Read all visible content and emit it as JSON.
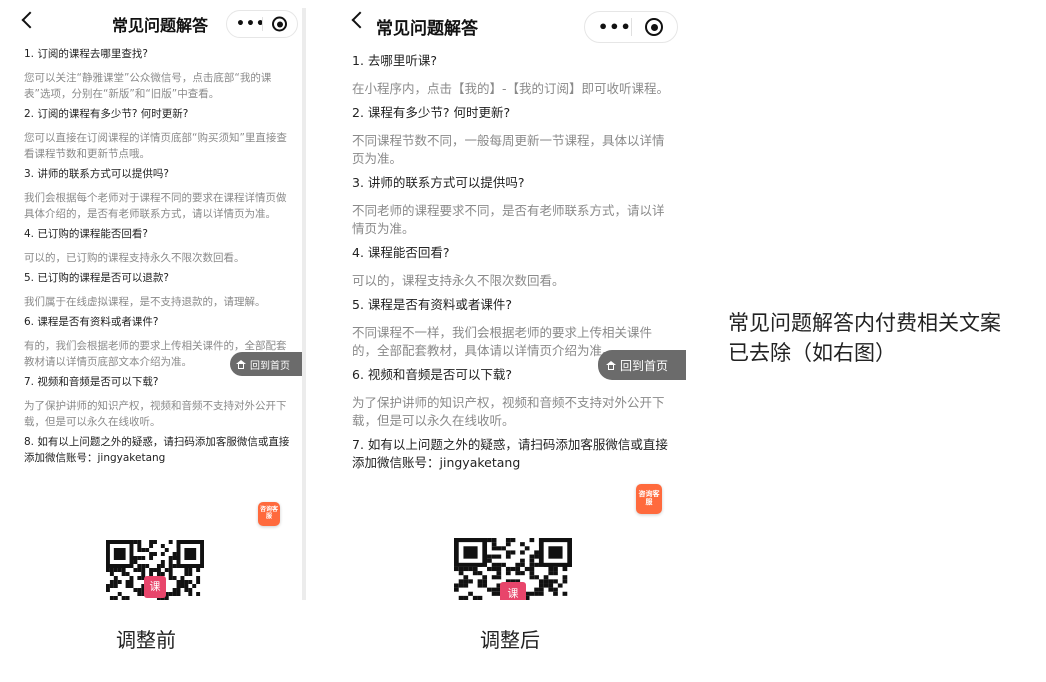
{
  "before": {
    "title": "常见问题解答",
    "faq": [
      {
        "q": "1. 订阅的课程去哪里查找?",
        "a": "您可以关注“静雅课堂”公众微信号，点击底部“我的课表”选项，分别在“新版”和“旧版”中查看。"
      },
      {
        "q": "2. 订阅的课程有多少节? 何时更新?",
        "a": "您可以直接在订阅课程的详情页底部“购买须知”里直接查看课程节数和更新节点哦。"
      },
      {
        "q": "3. 讲师的联系方式可以提供吗?",
        "a": "我们会根据每个老师对于课程不同的要求在课程详情页做具体介绍的，是否有老师联系方式，请以详情页为准。"
      },
      {
        "q": "4. 已订购的课程能否回看?",
        "a": "可以的，已订购的课程支持永久不限次数回看。"
      },
      {
        "q": "5. 已订购的课程是否可以退款?",
        "a": "我们属于在线虚拟课程，是不支持退款的，请理解。"
      },
      {
        "q": "6. 课程是否有资料或者课件?",
        "a": "有的，我们会根据老师的要求上传相关课件的，全部配套教材请以详情页底部文本介绍为准。"
      },
      {
        "q": "7. 视频和音频是否可以下载?",
        "a": "为了保护讲师的知识产权，视频和音频不支持对外公开下载，但是可以永久在线收听。"
      },
      {
        "q": "8. 如有以上问题之外的疑惑，请扫码添加客服微信或直接添加微信账号：jingyaketang",
        "a": ""
      }
    ],
    "home_button": "回到首页",
    "consult_button": "咨询客服",
    "qr_badge": "课"
  },
  "after": {
    "title": "常见问题解答",
    "faq": [
      {
        "q": "1. 去哪里听课?",
        "a": "在小程序内，点击【我的】-【我的订阅】即可收听课程。"
      },
      {
        "q": "2. 课程有多少节? 何时更新?",
        "a": "不同课程节数不同，一般每周更新一节课程，具体以详情页为准。"
      },
      {
        "q": "3. 讲师的联系方式可以提供吗?",
        "a": "不同老师的课程要求不同，是否有老师联系方式，请以详情页为准。"
      },
      {
        "q": "4. 课程能否回看?",
        "a": "可以的，课程支持永久不限次数回看。"
      },
      {
        "q": "5. 课程是否有资料或者课件?",
        "a": "不同课程不一样，我们会根据老师的要求上传相关课件的，全部配套教材，具体请以详情页介绍为准。"
      },
      {
        "q": "6. 视频和音频是否可以下载?",
        "a": "为了保护讲师的知识产权，视频和音频不支持对外公开下载，但是可以永久在线收听。"
      },
      {
        "q": "7. 如有以上问题之外的疑惑，请扫码添加客服微信或直接添加微信账号：jingyaketang",
        "a": ""
      }
    ],
    "home_button": "回到首页",
    "consult_button": "咨询客服",
    "qr_badge": "课"
  },
  "captions": {
    "before": "调整前",
    "after": "调整后"
  },
  "note": "常见问题解答内付费相关文案已去除（如右图）",
  "colors": {
    "home_button_bg": "#6b6b6b",
    "consult_button_bg": "#ff6a3d",
    "qr_badge_bg": "#e8456b"
  }
}
